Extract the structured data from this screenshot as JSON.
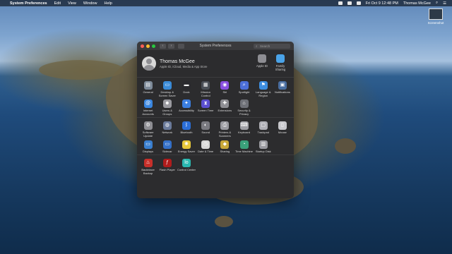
{
  "menubar": {
    "app_name": "System Preferences",
    "items": [
      "Edit",
      "View",
      "Window",
      "Help"
    ],
    "clock": "Fri Oct 9  12:48 PM",
    "user": "Thomas McGee"
  },
  "desktop": {
    "file_label": "Screenshot"
  },
  "window": {
    "title": "System Preferences",
    "search_placeholder": "Search"
  },
  "account": {
    "name": "Thomas McGee",
    "subtitle": "Apple ID, iCloud, Media & App Store",
    "right_items": [
      {
        "label": "Apple ID",
        "icon": "apple-logo-icon",
        "color": "#8e8e93"
      },
      {
        "label": "Family Sharing",
        "icon": "family-cloud-icon",
        "color": "#4aa3e8"
      }
    ]
  },
  "sections": [
    {
      "rows": [
        [
          {
            "label": "General",
            "icon": "general-icon",
            "color": "#7d8a99",
            "glyph": "▤"
          },
          {
            "label": "Desktop & Screen Saver",
            "icon": "desktop-icon",
            "color": "#3a8bd8",
            "glyph": "▭"
          },
          {
            "label": "Dock",
            "icon": "dock-icon",
            "color": "#2a2a2e",
            "glyph": "▬"
          },
          {
            "label": "Mission Control",
            "icon": "mission-control-icon",
            "color": "#4a4f57",
            "glyph": "▦"
          },
          {
            "label": "Siri",
            "icon": "siri-icon",
            "color": "#8a4fe0",
            "glyph": "◉"
          },
          {
            "label": "Spotlight",
            "icon": "spotlight-icon",
            "color": "#4c6fd8",
            "glyph": "⌕"
          },
          {
            "label": "Language & Region",
            "icon": "language-icon",
            "color": "#3d8ee0",
            "glyph": "⚑"
          },
          {
            "label": "Notifications",
            "icon": "notifications-icon",
            "color": "#4a6ea0",
            "glyph": "▣"
          }
        ],
        [
          {
            "label": "Internet Accounts",
            "icon": "internet-accounts-icon",
            "color": "#3a86e0",
            "glyph": "@"
          },
          {
            "label": "Users & Groups",
            "icon": "users-icon",
            "color": "#9a9aa0",
            "glyph": "☻"
          },
          {
            "label": "Accessibility",
            "icon": "accessibility-icon",
            "color": "#3b7ee0",
            "glyph": "✦"
          },
          {
            "label": "Screen Time",
            "icon": "screen-time-icon",
            "color": "#5b4fd0",
            "glyph": "⧗"
          },
          {
            "label": "Extensions",
            "icon": "extensions-icon",
            "color": "#8e8e93",
            "glyph": "✚"
          },
          {
            "label": "Security & Privacy",
            "icon": "security-icon",
            "color": "#6f7178",
            "glyph": "⌂"
          }
        ]
      ]
    },
    {
      "rows": [
        [
          {
            "label": "Software Update",
            "icon": "software-update-icon",
            "color": "#8e8e93",
            "glyph": "⚙"
          },
          {
            "label": "Network",
            "icon": "network-icon",
            "color": "#6a7a9a",
            "glyph": "◍"
          },
          {
            "label": "Bluetooth",
            "icon": "bluetooth-icon",
            "color": "#2b6ed8",
            "glyph": "ᛒ"
          },
          {
            "label": "Sound",
            "icon": "sound-icon",
            "color": "#7a7a80",
            "glyph": "◐"
          },
          {
            "label": "Printers & Scanners",
            "icon": "printer-icon",
            "color": "#9a9aa0",
            "glyph": "⎙"
          },
          {
            "label": "Keyboard",
            "icon": "keyboard-icon",
            "color": "#a0a0a6",
            "glyph": "⌨"
          },
          {
            "label": "Trackpad",
            "icon": "trackpad-icon",
            "color": "#b0b0b6",
            "glyph": "▢"
          },
          {
            "label": "Mouse",
            "icon": "mouse-icon",
            "color": "#c8c8cc",
            "glyph": "▯"
          }
        ],
        [
          {
            "label": "Displays",
            "icon": "displays-icon",
            "color": "#3a7fd0",
            "glyph": "▭"
          },
          {
            "label": "Sidecar",
            "icon": "sidecar-icon",
            "color": "#3470c8",
            "glyph": "▭"
          },
          {
            "label": "Energy Saver",
            "icon": "energy-saver-icon",
            "color": "#e8c83a",
            "glyph": "✺"
          },
          {
            "label": "Date & Time",
            "icon": "date-time-icon",
            "color": "#d8d8d8",
            "glyph": "◷"
          },
          {
            "label": "Sharing",
            "icon": "sharing-icon",
            "color": "#c8a83a",
            "glyph": "◆"
          },
          {
            "label": "Time Machine",
            "icon": "time-machine-icon",
            "color": "#3aa07a",
            "glyph": "◔"
          },
          {
            "label": "Startup Disk",
            "icon": "startup-disk-icon",
            "color": "#9a9aa0",
            "glyph": "▥"
          }
        ]
      ]
    },
    {
      "rows": [
        [
          {
            "label": "Backblaze Backup",
            "icon": "backblaze-icon",
            "color": "#c8302a",
            "glyph": "♨"
          },
          {
            "label": "Flash Player",
            "icon": "flash-player-icon",
            "color": "#b01c1c",
            "glyph": "ƒ"
          },
          {
            "label": "Control Center",
            "icon": "control-center-icon",
            "color": "#2ab8b0",
            "glyph": "lo"
          }
        ]
      ]
    }
  ]
}
